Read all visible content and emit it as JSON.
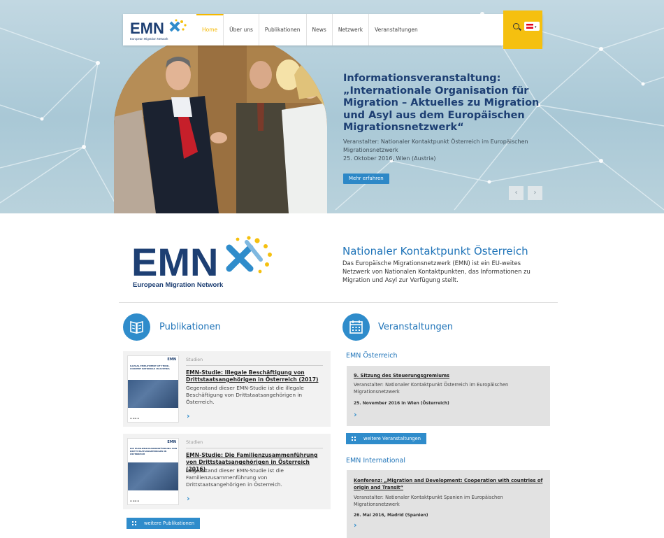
{
  "nav": {
    "logo_text": "EMN",
    "logo_sub": "European Migration Network",
    "items": [
      {
        "label": "Home",
        "active": true
      },
      {
        "label": "Über uns"
      },
      {
        "label": "Publikationen"
      },
      {
        "label": "News"
      },
      {
        "label": "Netzwerk"
      },
      {
        "label": "Veranstaltungen"
      }
    ],
    "search_icon": "search-icon",
    "language_flag": "austria-flag-icon",
    "accent_color": "#f5c00f"
  },
  "hero": {
    "title": "Informationsveranstaltung: „Internationale Organisation für Migration – Aktuelles zu Migration und Asyl aus dem Europäischen Migrationsnetzwerk“",
    "organizer": "Veranstalter: Nationaler Kontaktpunkt Österreich im Europäischen Migrationsnetzwerk",
    "date": "25. Oktober 2016, Wien (Austria)",
    "button": "Mehr erfahren",
    "prev": "‹",
    "next": "›"
  },
  "intro": {
    "logo_text": "EMN",
    "logo_sub": "European Migration Network",
    "title": "Nationaler Kontaktpunkt Österreich",
    "text": "Das Europäische Migrationsnetzwerk (EMN) ist ein EU-weites Netzwerk von Nationalen Kontaktpunkten, das Informationen zu Migration und Asyl zur Verfügung stellt."
  },
  "publikationen": {
    "title": "Publikationen",
    "items": [
      {
        "category": "Studien",
        "title": "EMN-Studie: Illegale Beschäftigung von Drittstaatsangehörigen in Österreich (2017)",
        "desc": "Gegenstand dieser EMN-Studie ist die illegale Beschäftigung von Drittstaatsangehörigen in Österreich.",
        "cover_title": "ILLEGAL EMPLOYMENT OF THIRD-COUNTRY NATIONALS IN AUSTRIA"
      },
      {
        "category": "Studien",
        "title": "EMN-Studie: Die Familienzusammenführung von Drittstaatsangehörigen in Österreich (2016)",
        "desc": "Gegenstand dieser EMN-Studie ist die Familienzusammenführung von Drittstaatsangehörigen in Österreich.",
        "cover_title": "DIE FAMILIENZUSAMMENFÜHRUNG VON DRITTSTAATSANGEHÖRIGEN IN ÖSTERREICH"
      }
    ],
    "more": "weitere Publikationen"
  },
  "veranstaltungen": {
    "title": "Veranstaltungen",
    "austria": {
      "heading": "EMN Österreich",
      "title": "9. Sitzung des Steuerungsgremiums",
      "organizer": "Veranstalter: Nationaler Kontaktpunkt Österreich im Europäischen Migrationsnetzwerk",
      "date": "25. November 2016 in Wien (Österreich)"
    },
    "more": "weitere Veranstaltungen",
    "international": {
      "heading": "EMN International",
      "title": "Konferenz: „Migration and Development: Cooperation with countries of origin and Transit“",
      "organizer": "Veranstalter: Nationaler Kontaktpunkt Spanien im Europäischen Migrationsnetzwerk",
      "date": "26. Mai 2016, Madrid (Spanien)"
    }
  },
  "colors": {
    "primary": "#2f8ccb",
    "heading": "#1e73b8",
    "dark_blue": "#1d3f73",
    "gold": "#f5c00f"
  }
}
